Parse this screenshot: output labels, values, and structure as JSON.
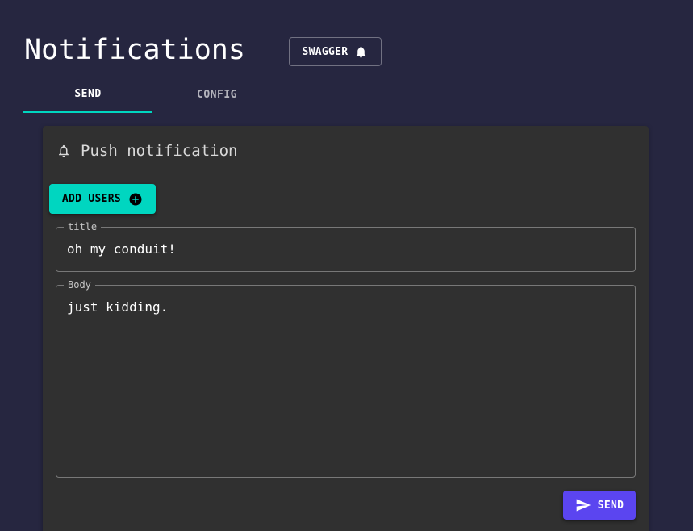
{
  "page": {
    "title": "Notifications"
  },
  "header": {
    "swagger_label": "SWAGGER",
    "swagger_icon": "bell-icon"
  },
  "tabs": [
    {
      "label": "SEND",
      "active": true
    },
    {
      "label": "CONFIG",
      "active": false
    }
  ],
  "card": {
    "icon": "bell-outline-icon",
    "title": "Push notification",
    "add_users_label": "ADD USERS",
    "add_users_icon": "plus-circle-icon",
    "title_field": {
      "label": "title",
      "value": "oh my conduit!"
    },
    "body_field": {
      "label": "Body",
      "value": "just kidding."
    },
    "send_label": "SEND",
    "send_icon": "send-icon"
  },
  "colors": {
    "background": "#262640",
    "card": "#303030",
    "accent_teal": "#00d6c0",
    "accent_purple": "#5b45f0"
  }
}
